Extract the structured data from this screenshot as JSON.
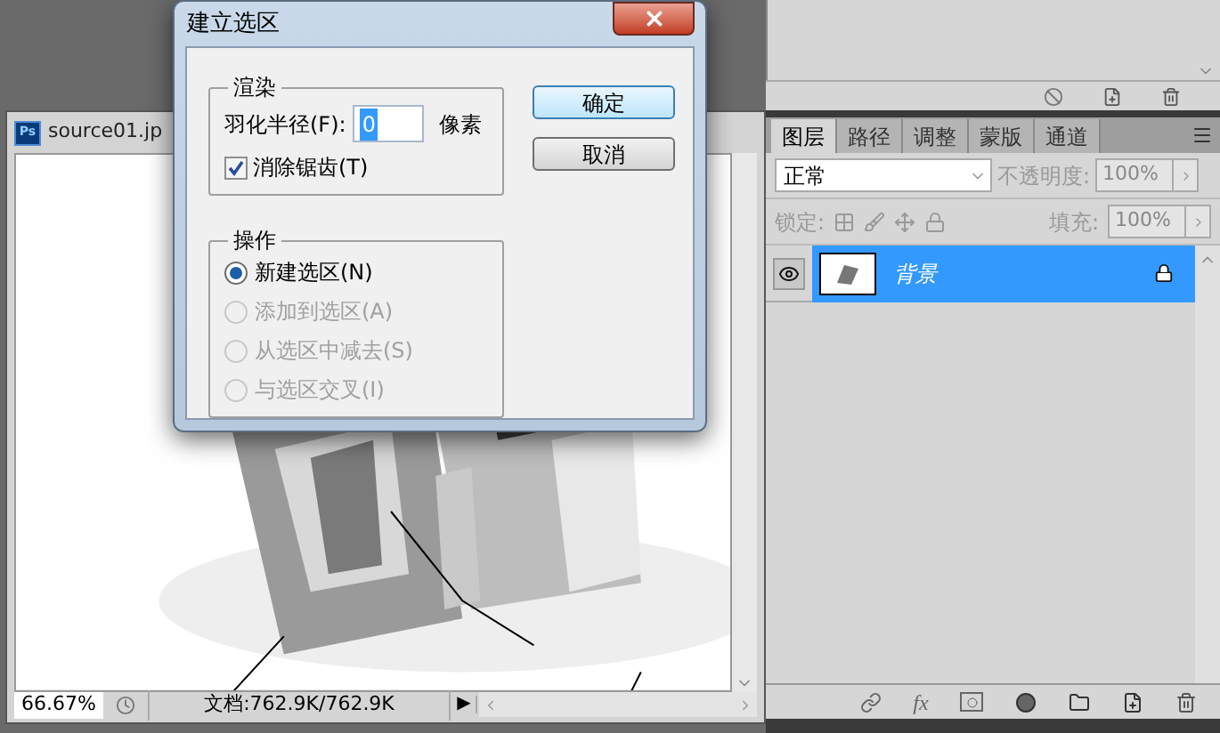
{
  "document": {
    "logo": "Ps",
    "title": "source01.jp",
    "zoom": "66.67%",
    "status": "文档:762.9K/762.9K",
    "status_arrow": "▶"
  },
  "dialog": {
    "title": "建立选区",
    "render_group": {
      "title": "渲染",
      "feather_label": "羽化半径(F):",
      "feather_value": "0",
      "feather_unit": "像素",
      "antialias": {
        "label": "消除锯齿(T)",
        "checked": true
      }
    },
    "operation_group": {
      "title": "操作",
      "options": [
        {
          "label": "新建选区(N)",
          "selected": true,
          "disabled": false
        },
        {
          "label": "添加到选区(A)",
          "selected": false,
          "disabled": true
        },
        {
          "label": "从选区中减去(S)",
          "selected": false,
          "disabled": true
        },
        {
          "label": "与选区交叉(I)",
          "selected": false,
          "disabled": true
        }
      ]
    },
    "buttons": [
      {
        "label": "确定",
        "default": true
      },
      {
        "label": "取消",
        "default": false
      }
    ]
  },
  "layers_panel": {
    "tabs": [
      {
        "label": "图层",
        "selected": true
      },
      {
        "label": "路径",
        "selected": false
      },
      {
        "label": "调整",
        "selected": false
      },
      {
        "label": "蒙版",
        "selected": false
      },
      {
        "label": "通道",
        "selected": false
      }
    ],
    "blend_mode": "正常",
    "opacity_label": "不透明度:",
    "opacity": "100%",
    "lock_label": "锁定:",
    "fill_label": "填充:",
    "fill": "100%",
    "fx_label": "fx",
    "layers": [
      {
        "name": "背景",
        "selected": true,
        "visible": true,
        "locked": true
      }
    ]
  }
}
